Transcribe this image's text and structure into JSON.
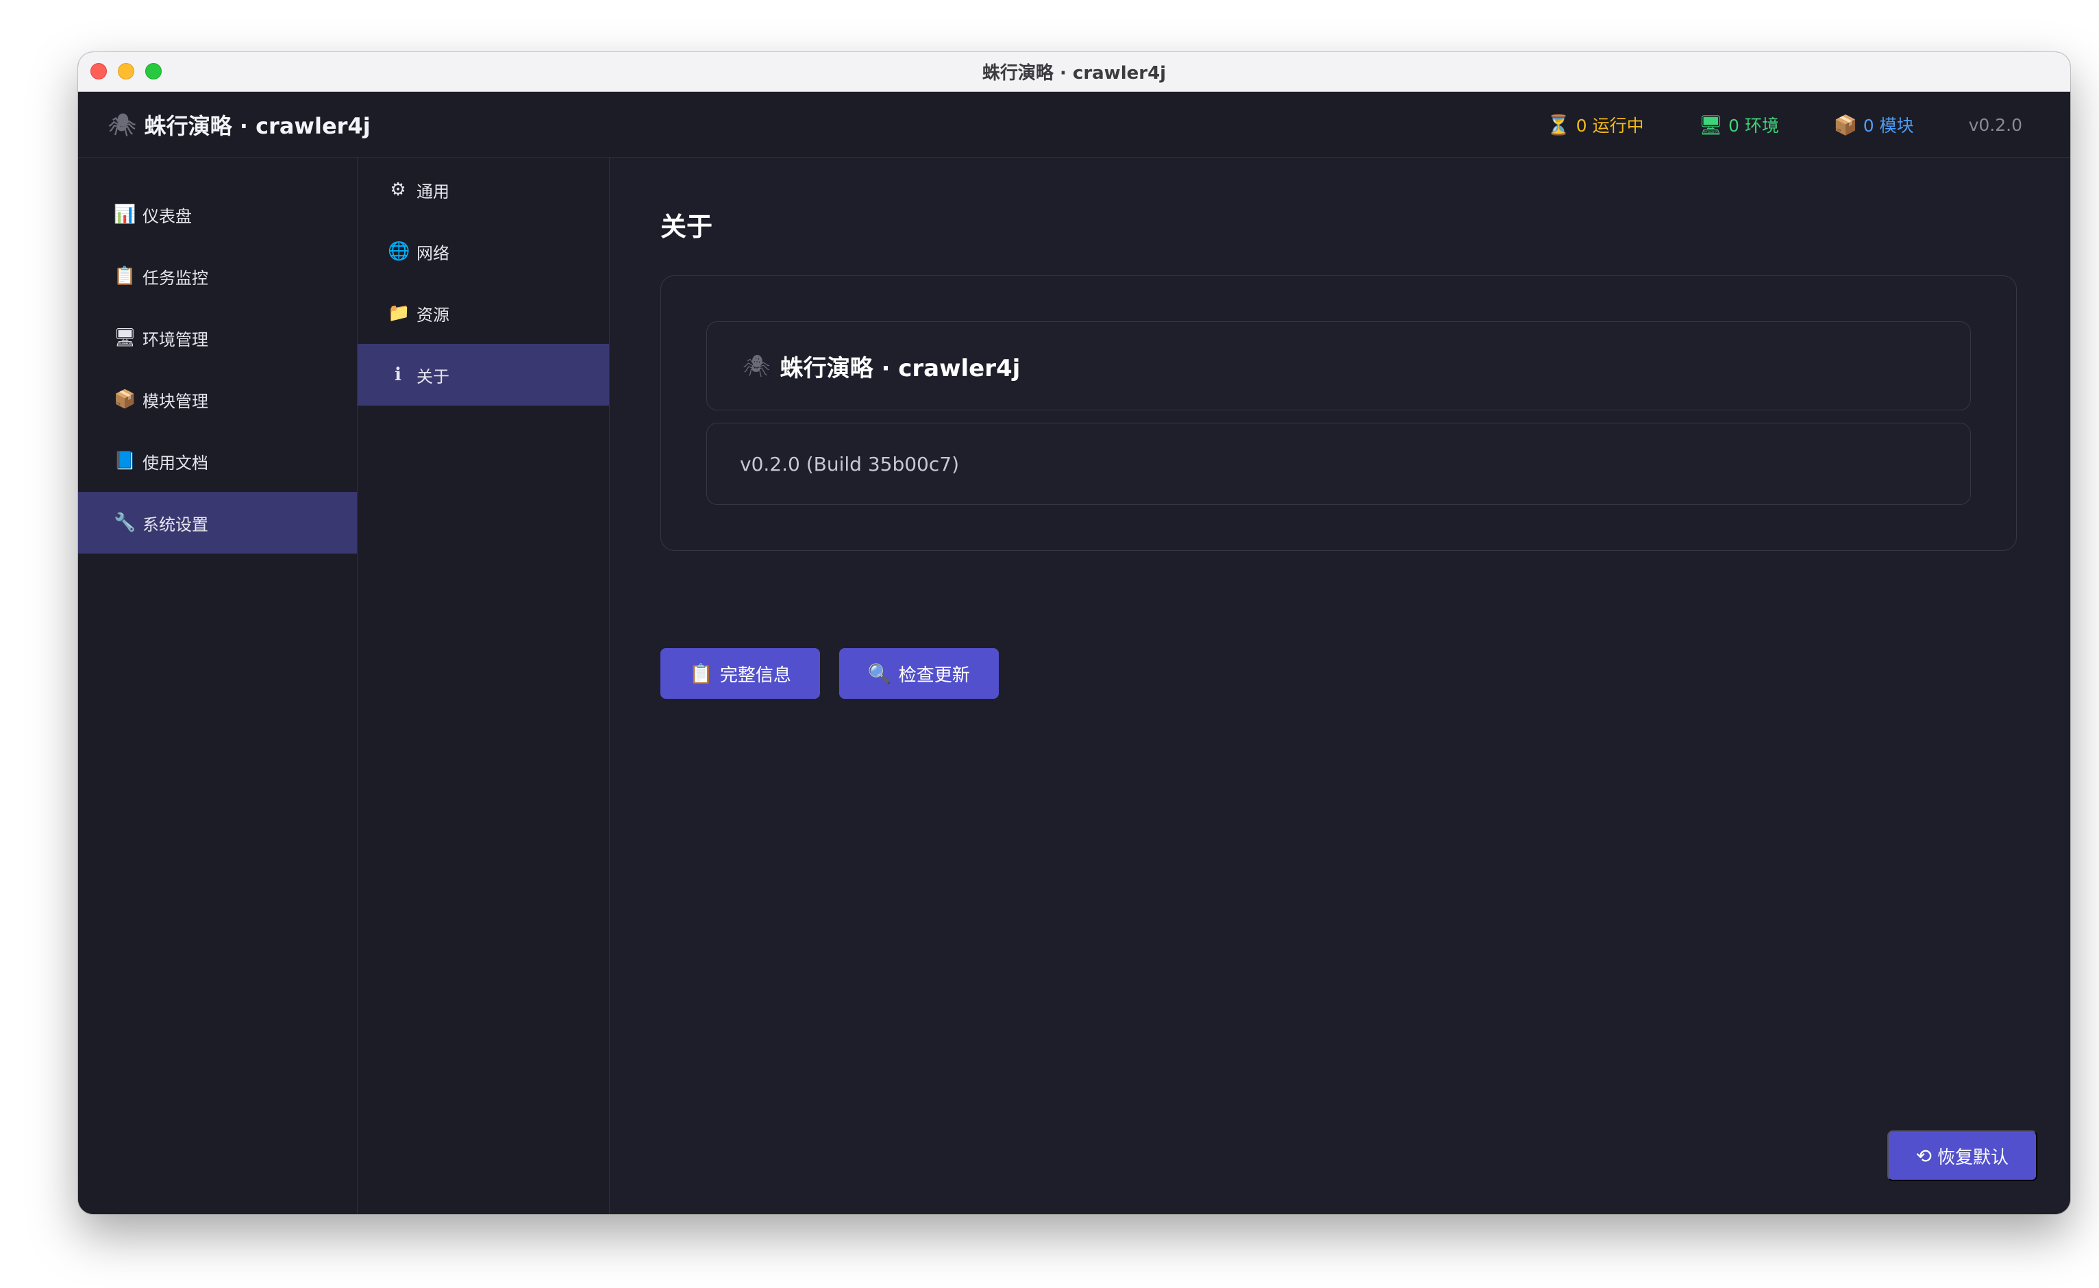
{
  "window": {
    "title": "蛛行演略 · crawler4j"
  },
  "header": {
    "brand_icon": "🕷",
    "brand": "蛛行演略 · crawler4j",
    "stats": {
      "running_icon": "⏳",
      "running": "0 运行中",
      "env_icon": "🖥",
      "env": "0 环境",
      "modules_icon": "📦",
      "modules": "0 模块"
    },
    "version": "v0.2.0",
    "colors": {
      "running": "#f5b91b",
      "env": "#3dd47a",
      "modules": "#4d9cf5"
    }
  },
  "sidebar": {
    "items": [
      {
        "icon": "📊",
        "label": "仪表盘"
      },
      {
        "icon": "📋",
        "label": "任务监控"
      },
      {
        "icon": "🖥",
        "label": "环境管理"
      },
      {
        "icon": "📦",
        "label": "模块管理"
      },
      {
        "icon": "📘",
        "label": "使用文档"
      },
      {
        "icon": "🔧",
        "label": "系统设置"
      }
    ],
    "active_index": 5
  },
  "subnav": {
    "items": [
      {
        "icon": "⚙",
        "label": "通用"
      },
      {
        "icon": "🌐",
        "label": "网络"
      },
      {
        "icon": "📁",
        "label": "资源"
      },
      {
        "icon": "ℹ",
        "label": "关于"
      }
    ],
    "active_index": 3
  },
  "main": {
    "title": "关于",
    "app_icon": "🕷",
    "app_name": "蛛行演略 · crawler4j",
    "build": "v0.2.0 (Build 35b00c7)",
    "buttons": {
      "full_info_icon": "📋",
      "full_info": "完整信息",
      "check_update_icon": "🔍",
      "check_update": "检查更新"
    },
    "reset_icon": "⟲",
    "reset": "恢复默认"
  },
  "accent_color": "#5250cc"
}
